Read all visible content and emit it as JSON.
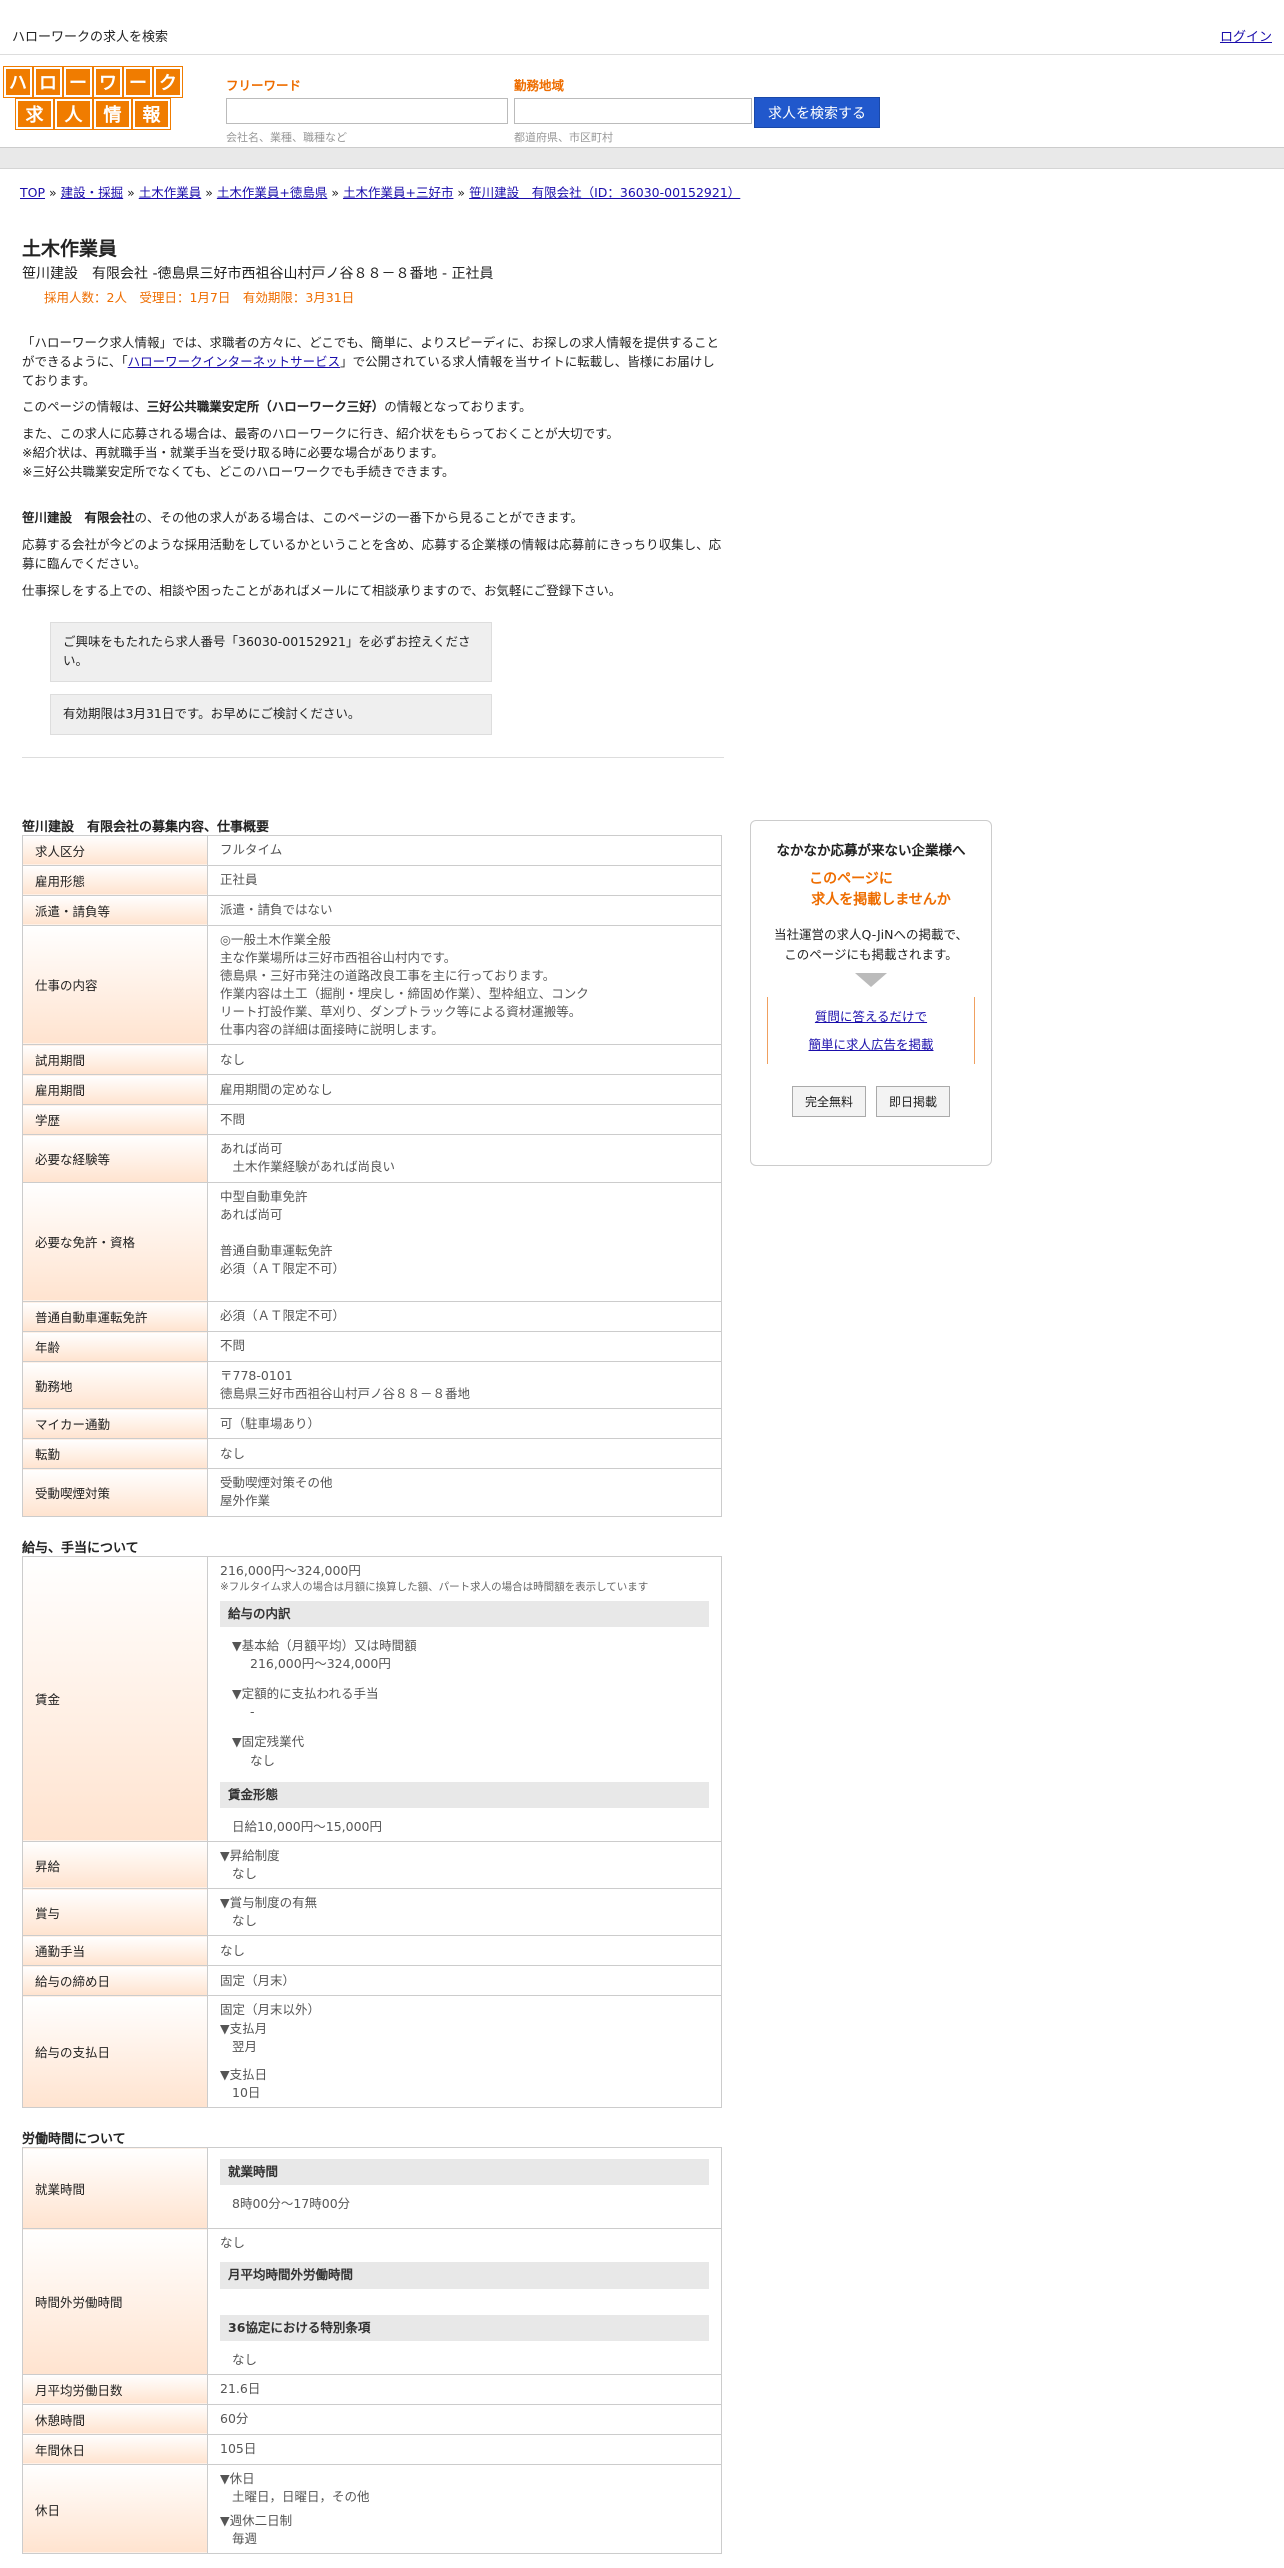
{
  "topbar": {
    "site_title": "ハローワークの求人を検索",
    "login": "ログイン"
  },
  "logo": {
    "row1": [
      "ハ",
      "ロ",
      "ー",
      "ワ",
      "ー",
      "ク"
    ],
    "row2": [
      "求",
      "人",
      "情",
      "報"
    ]
  },
  "search": {
    "freeword_label": "フリーワード",
    "freeword_placeholder": "会社名、業種、職種など",
    "area_label": "勤務地域",
    "area_placeholder": "都道府県、市区町村",
    "button": "求人を検索する"
  },
  "breadcrumb": [
    "TOP",
    "建設・採掘",
    "土木作業員",
    "土木作業員+徳島県",
    "土木作業員+三好市",
    "笹川建設　有限会社（ID：36030-00152921）"
  ],
  "job": {
    "title": "土木作業員",
    "subtitle": "笹川建設　有限会社 -徳島県三好市西祖谷山村戸ノ谷８８－８番地 - 正社員",
    "meta": "採用人数：2人　受理日：1月7日　有効期限：3月31日"
  },
  "intro": {
    "p1a": "「ハローワーク求人情報」では、求職者の方々に、どこでも、簡単に、よりスピーディに、お探しの求人情報を提供することができるように、「",
    "p1link": "ハローワークインターネットサービス",
    "p1b": "」で公開されている求人情報を当サイトに転載し、皆様にお届けしております。",
    "p2a": "このページの情報は、",
    "p2b": "三好公共職業安定所（ハローワーク三好）",
    "p2c": "の情報となっております。",
    "p3": "また、この求人に応募される場合は、最寄のハローワークに行き、紹介状をもらっておくことが大切です。",
    "p4": "※紹介状は、再就職手当・就業手当を受け取る時に必要な場合があります。",
    "p5": "※三好公共職業安定所でなくても、どこのハローワークでも手続きできます。",
    "p6a": "笹川建設　有限会社",
    "p6b": "の、その他の求人がある場合は、このページの一番下から見ることができます。",
    "p7": "応募する会社が今どのような採用活動をしているかということを含め、応募する企業様の情報は応募前にきっちり収集し、応募に臨んでください。",
    "p8": "仕事探しをする上での、相談や困ったことがあればメールにて相談承りますので、お気軽にご登録下さい。"
  },
  "notes": [
    "ご興味をもたれたら求人番号「36030-00152921」を必ずお控えください。",
    "有効期限は3月31日です。お早めにご検討ください。"
  ],
  "section1": {
    "title": "笹川建設　有限会社の募集内容、仕事概要",
    "rows": [
      {
        "k": "求人区分",
        "v": [
          "フルタイム"
        ]
      },
      {
        "k": "雇用形態",
        "v": [
          "正社員"
        ]
      },
      {
        "k": "派遣・請負等",
        "v": [
          "派遣・請負ではない"
        ]
      },
      {
        "k": "仕事の内容",
        "v": [
          "◎一般土木作業全般",
          "主な作業場所は三好市西祖谷山村内です。",
          "徳島県・三好市発注の道路改良工事を主に行っております。",
          "作業内容は土工（掘削・埋戻し・締固め作業）、型枠組立、コンク",
          "リート打設作業、草刈り、ダンプトラック等による資材運搬等。",
          "仕事内容の詳細は面接時に説明します。"
        ]
      },
      {
        "k": "試用期間",
        "v": [
          "なし"
        ]
      },
      {
        "k": "雇用期間",
        "v": [
          "雇用期間の定めなし"
        ]
      },
      {
        "k": "学歴",
        "v": [
          "不問"
        ]
      },
      {
        "k": "必要な経験等",
        "v": [
          "あれば尚可",
          "　土木作業経験があれば尚良い"
        ]
      },
      {
        "k": "必要な免許・資格",
        "v": [
          "中型自動車免許",
          "あれば尚可",
          "",
          "普通自動車運転免許",
          "必須（ＡＴ限定不可）",
          ""
        ]
      },
      {
        "k": "普通自動車運転免許",
        "v": [
          "必須（ＡＴ限定不可）"
        ]
      },
      {
        "k": "年齢",
        "v": [
          "不問"
        ]
      },
      {
        "k": "勤務地",
        "v": [
          "〒778-0101",
          "徳島県三好市西祖谷山村戸ノ谷８８－８番地"
        ]
      },
      {
        "k": "マイカー通勤",
        "v": [
          "可（駐車場あり）"
        ]
      },
      {
        "k": "転勤",
        "v": [
          "なし"
        ]
      },
      {
        "k": "受動喫煙対策",
        "v": [
          "受動喫煙対策その他",
          "屋外作業"
        ]
      }
    ]
  },
  "section2": {
    "title": "給与、手当について",
    "wage_label": "賃金",
    "wage_range": "216,000円〜324,000円",
    "wage_note": "※フルタイム求人の場合は月額に換算した額、パート求人の場合は時間額を表示しています",
    "breakdown_head": "給与の内訳",
    "base_label": "▼基本給（月額平均）又は時間額",
    "base_value": "216,000円〜324,000円",
    "fixed_allow_label": "▼定額的に支払われる手当",
    "fixed_allow_value": "-",
    "fixed_ot_label": "▼固定残業代",
    "fixed_ot_value": "なし",
    "wage_form_head": "賃金形態",
    "wage_form_value": "日給10,000円〜15,000円",
    "raise_label": "昇給",
    "raise_sub": "▼昇給制度",
    "raise_value": "なし",
    "bonus_label": "賞与",
    "bonus_sub": "▼賞与制度の有無",
    "bonus_value": "なし",
    "commute_label": "通勤手当",
    "commute_value": "なし",
    "closing_label": "給与の締め日",
    "closing_value": "固定（月末）",
    "payday_label": "給与の支払日",
    "payday_v1": "固定（月末以外）",
    "payday_v2": "▼支払月",
    "payday_v3": "翌月",
    "payday_v4": "▼支払日",
    "payday_v5": "10日"
  },
  "section3": {
    "title": "労働時間について",
    "hours_label": "就業時間",
    "hours_head": "就業時間",
    "hours_value": "8時00分〜17時00分",
    "ot_label": "時間外労働時間",
    "ot_value": "なし",
    "ot_head1": "月平均時間外労働時間",
    "ot_head2": "36協定における特別条項",
    "ot_value2": "なし",
    "days_label": "月平均労働日数",
    "days_value": "21.6日",
    "break_label": "休憩時間",
    "break_value": "60分",
    "holidays_label": "年間休日",
    "holidays_value": "105日",
    "off_label": "休日",
    "off_v1": "▼休日",
    "off_v2": "土曜日，日曜日，その他",
    "off_v3": "▼週休二日制",
    "off_v4": "毎週"
  },
  "sidebar": {
    "title": "なかなか応募が来ない企業様へ",
    "offer1": "このページに",
    "offer2": "求人を掲載しませんか",
    "desc1": "当社運営の求人Q-JiNへの掲載で、",
    "desc2": "このページにも掲載されます。",
    "link1": "質問に答えるだけで",
    "link2": "簡単に求人広告を掲載",
    "btn1": "完全無料",
    "btn2": "即日掲載"
  }
}
